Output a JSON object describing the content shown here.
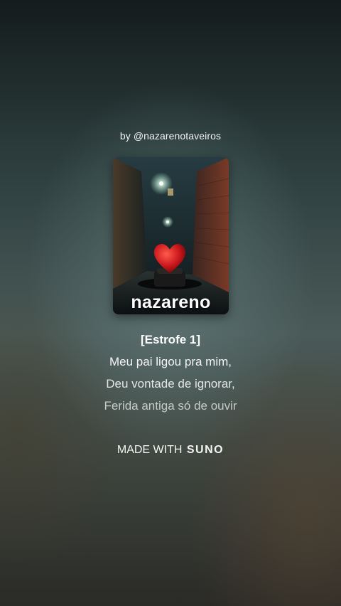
{
  "byline": "by @nazarenotaveiros",
  "cover": {
    "title": "nazareno",
    "image": "dark-alley-heart-artwork"
  },
  "lyrics": {
    "heading": "[Estrofe 1]",
    "lines": [
      "Meu pai ligou pra mim,",
      "Deu vontade de ignorar,",
      "Ferida antiga só de ouvir"
    ]
  },
  "footer": {
    "made_with": "MADE WITH",
    "brand": "SUNO"
  },
  "colors": {
    "heart": "#c8161c",
    "lamp": "#dfffe8"
  }
}
